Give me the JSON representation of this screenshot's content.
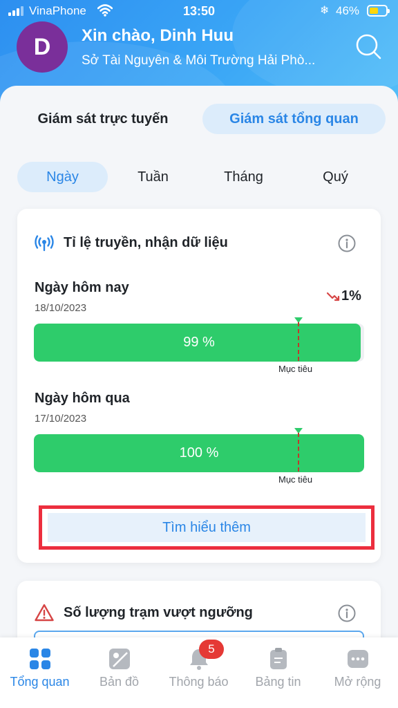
{
  "status_bar": {
    "carrier": "VinaPhone",
    "time": "13:50",
    "battery_percent": "46%",
    "battery_level": 0.46,
    "icons": [
      "signal-icon",
      "wifi-icon",
      "snowflake-icon",
      "battery-icon"
    ]
  },
  "header": {
    "avatar_initial": "D",
    "avatar_color": "#7a2f9a",
    "greeting": "Xin chào, Dinh Huu",
    "organization": "Sở Tài Nguyên & Môi Trường Hải Phò...",
    "search_icon": "search-icon"
  },
  "mode_tabs": {
    "online": "Giám sát trực tuyến",
    "overview": "Giám sát tổng quan",
    "selected": "overview"
  },
  "period_tabs": {
    "items": [
      "Ngày",
      "Tuần",
      "Tháng",
      "Quý"
    ],
    "selected": "Ngày"
  },
  "transmission_card": {
    "icon": "broadcast-icon",
    "title": "Tỉ lệ truyền, nhận dữ liệu",
    "info_icon": "info-icon",
    "today": {
      "label": "Ngày hôm nay",
      "date": "18/10/2023",
      "value": 99,
      "value_text": "99 %",
      "trend_text": "1%",
      "trend_direction": "down",
      "target_label": "Mục tiêu"
    },
    "yesterday": {
      "label": "Ngày hôm qua",
      "date": "17/10/2023",
      "value": 100,
      "value_text": "100 %",
      "target_label": "Mục tiêu"
    },
    "learn_more": "Tìm hiểu thêm"
  },
  "threshold_card": {
    "icon": "warning-icon",
    "title": "Số lượng trạm vượt ngưỡng",
    "info_icon": "info-icon"
  },
  "tab_bar": {
    "items": [
      {
        "label": "Tổng quan",
        "icon": "dashboard-icon"
      },
      {
        "label": "Bản đồ",
        "icon": "map-icon"
      },
      {
        "label": "Thông báo",
        "icon": "bell-icon"
      },
      {
        "label": "Bảng tin",
        "icon": "clipboard-icon"
      },
      {
        "label": "Mở rộng",
        "icon": "more-icon"
      }
    ],
    "selected": "Tổng quan",
    "notification_count": "5"
  },
  "colors": {
    "accent": "#2a86e6",
    "success": "#2ecc6b",
    "highlight_border": "#ec2e3e",
    "badge": "#e53935"
  }
}
